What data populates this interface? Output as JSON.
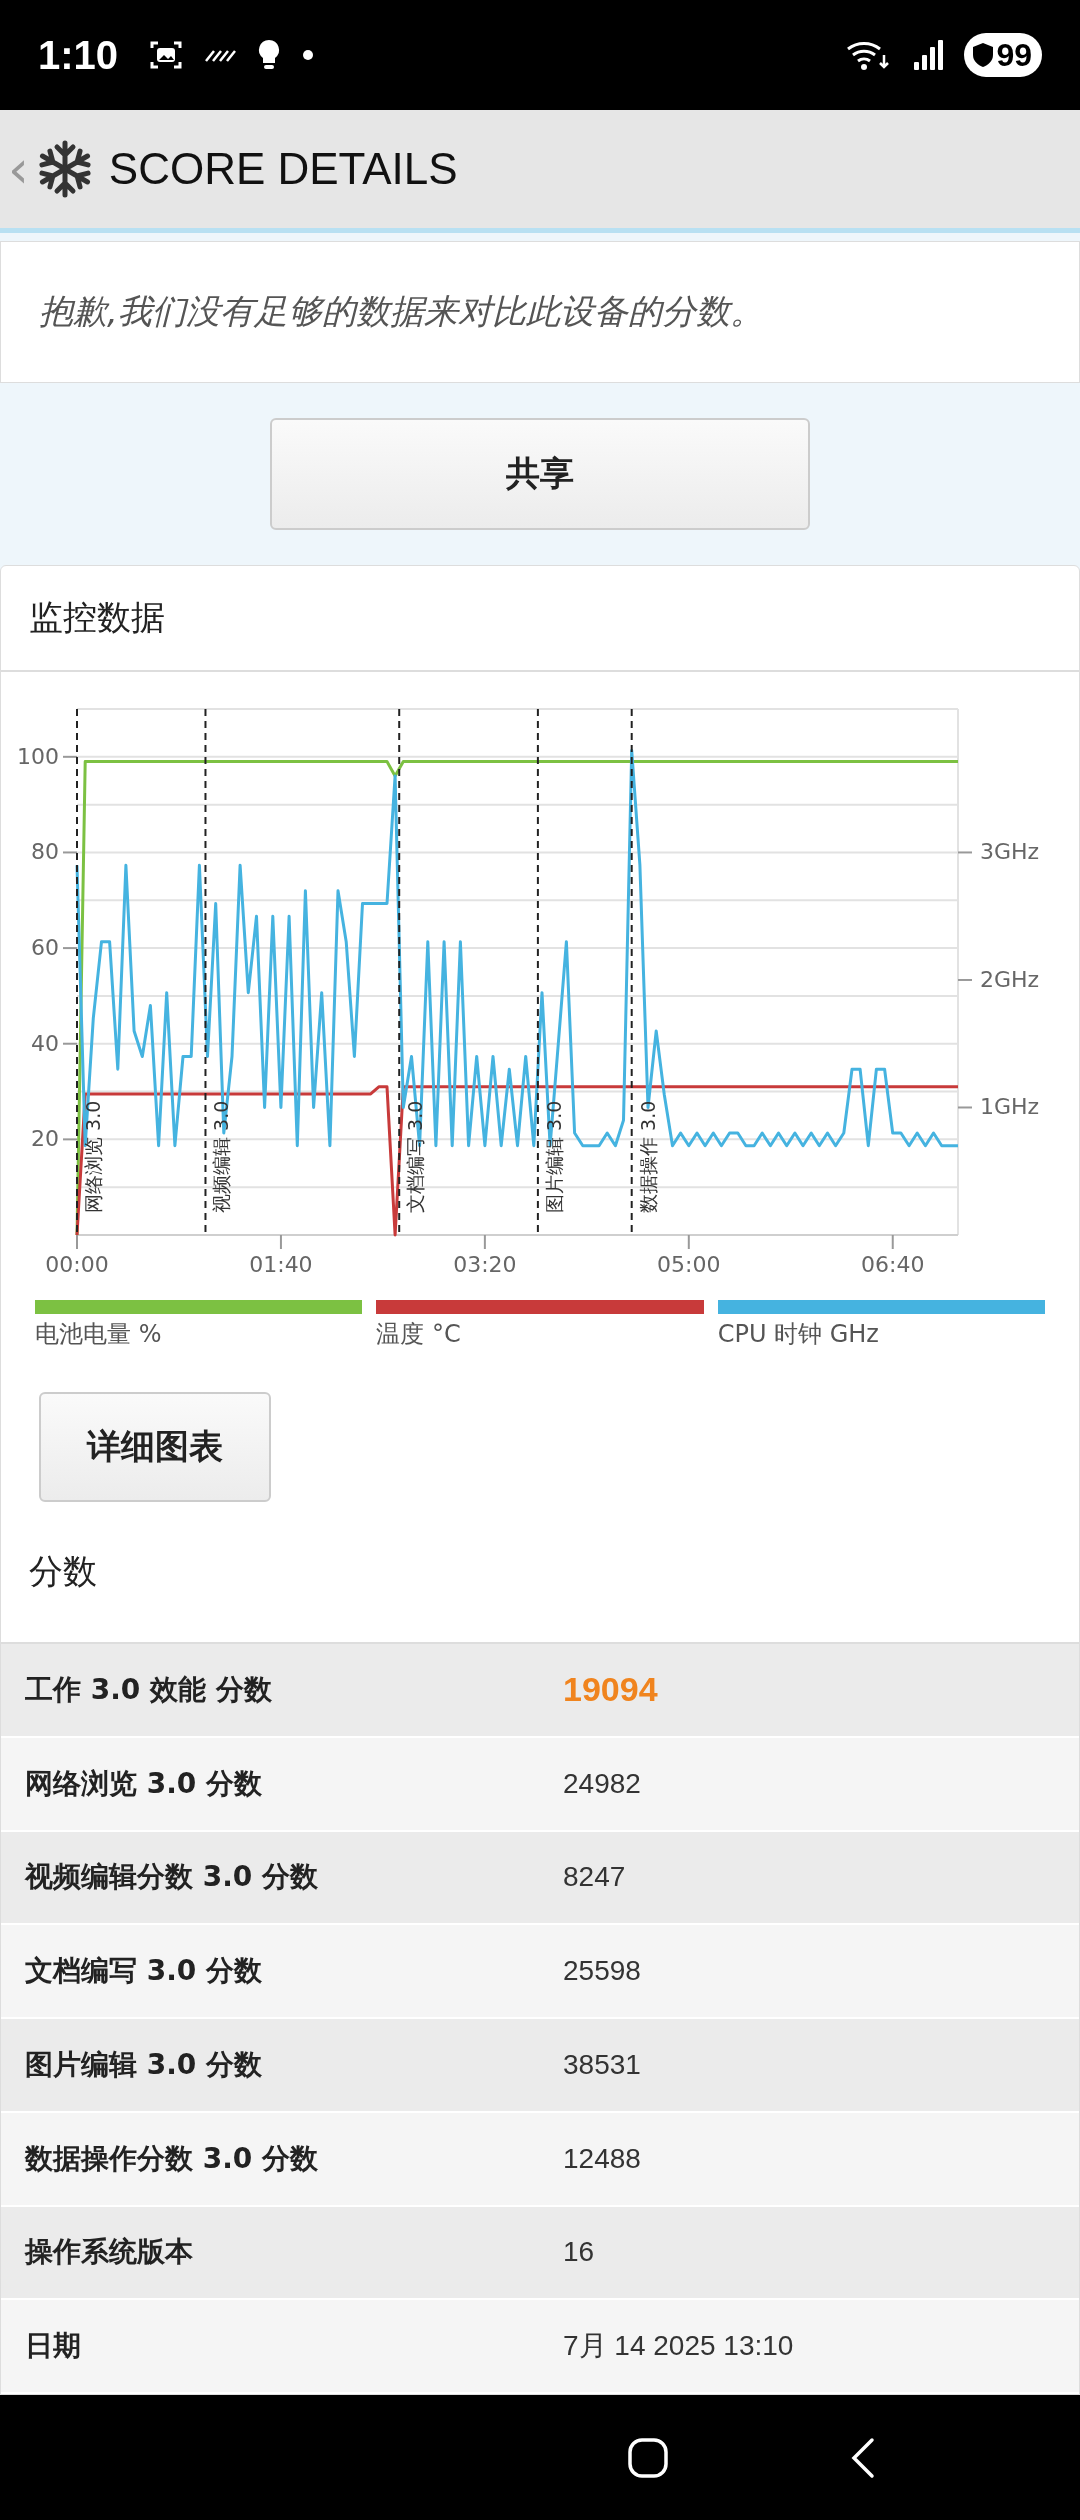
{
  "status_bar": {
    "time": "1:10",
    "battery": "99"
  },
  "header": {
    "back": "‹",
    "title": "SCORE DETAILS"
  },
  "notice": "抱歉,我们没有足够的数据来对比此设备的分数。",
  "share_button": "共享",
  "monitoring": {
    "title": "监控数据",
    "chart_data": {
      "type": "line",
      "xlim": [
        0,
        432
      ],
      "ylim": [
        0,
        110
      ],
      "y2lim": [
        0,
        4.125
      ],
      "x": [
        0,
        4,
        8,
        12,
        16,
        20,
        24,
        28,
        32,
        36,
        40,
        44,
        48,
        52,
        56,
        60,
        64,
        68,
        72,
        76,
        80,
        84,
        88,
        92,
        96,
        100,
        104,
        108,
        112,
        116,
        120,
        124,
        128,
        132,
        136,
        140,
        144,
        148,
        152,
        156,
        160,
        164,
        168,
        172,
        176,
        180,
        184,
        188,
        192,
        196,
        200,
        204,
        208,
        212,
        216,
        220,
        224,
        228,
        232,
        236,
        240,
        244,
        248,
        252,
        256,
        260,
        264,
        268,
        272,
        276,
        280,
        284,
        288,
        292,
        296,
        300,
        304,
        308,
        312,
        316,
        320,
        324,
        328,
        332,
        336,
        340,
        344,
        348,
        352,
        356,
        360,
        364,
        368,
        372,
        376,
        380,
        384,
        388,
        392,
        396,
        400,
        404,
        408,
        412,
        416,
        420,
        424,
        428,
        432
      ],
      "xticks": [
        {
          "value": 0,
          "label": "00:00"
        },
        {
          "value": 100,
          "label": "01:40"
        },
        {
          "value": 200,
          "label": "03:20"
        },
        {
          "value": 300,
          "label": "05:00"
        },
        {
          "value": 400,
          "label": "06:40"
        }
      ],
      "yticks": [
        20,
        40,
        60,
        80,
        100
      ],
      "y2ticks": [
        {
          "value": 1,
          "label": "1GHz"
        },
        {
          "value": 2,
          "label": "2GHz"
        },
        {
          "value": 3,
          "label": "3GHz"
        }
      ],
      "series": [
        {
          "name": "电池电量 %",
          "color": "#7cc142",
          "values": [
            0,
            99,
            99,
            99,
            99,
            99,
            99,
            99,
            99,
            99,
            99,
            99,
            99,
            99,
            99,
            99,
            99,
            99,
            99,
            99,
            99,
            99,
            99,
            99,
            99,
            99,
            99,
            99,
            99,
            99,
            99,
            99,
            99,
            99,
            99,
            99,
            99,
            99,
            99,
            96,
            99,
            99,
            99,
            99,
            99,
            99,
            99,
            99,
            99,
            99,
            99,
            99,
            99,
            99,
            99,
            99,
            99,
            99,
            99,
            99,
            99,
            99,
            99,
            99,
            99,
            99,
            99,
            99,
            99,
            99,
            99,
            99,
            99,
            99,
            99,
            99,
            99,
            99,
            99,
            99,
            99,
            99,
            99,
            99,
            99,
            99,
            99,
            99,
            99,
            99,
            99,
            99,
            99,
            99,
            99,
            99,
            99,
            99,
            99,
            99,
            99,
            99,
            99,
            99,
            99,
            99,
            99,
            99,
            99
          ]
        },
        {
          "name": "温度 °C",
          "color": "#c83a3a",
          "values": [
            0,
            29.5,
            29.5,
            29.5,
            29.5,
            29.5,
            29.5,
            29.5,
            29.5,
            29.5,
            29.5,
            29.5,
            29.5,
            29.5,
            29.5,
            29.5,
            29.5,
            29.5,
            29.5,
            29.5,
            29.5,
            29.5,
            29.5,
            29.5,
            29.5,
            29.5,
            29.5,
            29.5,
            29.5,
            29.5,
            29.5,
            29.5,
            29.5,
            29.5,
            29.5,
            29.5,
            29.5,
            31,
            31,
            0,
            31,
            31,
            31,
            31,
            31,
            31,
            31,
            31,
            31,
            31,
            31,
            31,
            31,
            31,
            31,
            31,
            31,
            31,
            31,
            31,
            31,
            31,
            31,
            31,
            31,
            31,
            31,
            31,
            31,
            31,
            31,
            31,
            31,
            31,
            31,
            31,
            31,
            31,
            31,
            31,
            31,
            31,
            31,
            31,
            31,
            31,
            31,
            31,
            31,
            31,
            31,
            31,
            31,
            31,
            31,
            31,
            31,
            31,
            31,
            31,
            31,
            31,
            31,
            31,
            31,
            31,
            31,
            31,
            31
          ]
        },
        {
          "name": "CPU 时钟 GHz",
          "color": "#45b3e0",
          "axis": "y2",
          "values": [
            2.9,
            0.7,
            1.7,
            2.3,
            2.3,
            1.3,
            2.9,
            1.6,
            1.4,
            1.8,
            0.7,
            1.9,
            0.7,
            1.4,
            1.4,
            2.9,
            1.4,
            2.6,
            0.8,
            1.4,
            2.9,
            1.9,
            2.5,
            1.0,
            2.5,
            1.0,
            2.5,
            0.7,
            2.7,
            1.0,
            1.9,
            0.7,
            2.7,
            2.3,
            1.4,
            2.6,
            2.6,
            2.6,
            2.6,
            3.6,
            1.0,
            1.4,
            0.7,
            2.3,
            0.7,
            2.3,
            0.7,
            2.3,
            0.7,
            1.4,
            0.7,
            1.4,
            0.7,
            1.3,
            0.7,
            1.4,
            0.7,
            1.9,
            0.7,
            1.5,
            2.3,
            0.8,
            0.7,
            0.7,
            0.7,
            0.8,
            0.7,
            0.9,
            3.8,
            2.9,
            1.0,
            1.6,
            1.1,
            0.7,
            0.8,
            0.7,
            0.8,
            0.7,
            0.8,
            0.7,
            0.8,
            0.8,
            0.7,
            0.7,
            0.8,
            0.7,
            0.8,
            0.7,
            0.8,
            0.7,
            0.8,
            0.7,
            0.8,
            0.7,
            0.8,
            1.3,
            1.3,
            0.7,
            1.3,
            1.3,
            0.8,
            0.8,
            0.7,
            0.8,
            0.7,
            0.8,
            0.7,
            0.7,
            0.7
          ]
        }
      ],
      "grid": true,
      "ref_lines": [
        {
          "axis": "x",
          "value": 0,
          "label": "网络浏览 3.0"
        },
        {
          "axis": "x",
          "value": 63,
          "label": "视频编辑 3.0"
        },
        {
          "axis": "x",
          "value": 158,
          "label": "文档编写 3.0"
        },
        {
          "axis": "x",
          "value": 226,
          "label": "图片编辑 3.0"
        },
        {
          "axis": "x",
          "value": 272,
          "label": "数据操作 3.0"
        }
      ]
    },
    "detail_button": "详细图表"
  },
  "scores": {
    "title": "分数",
    "rows": [
      {
        "label": "工作 3.0 效能 分数",
        "value": "19094",
        "emphasized": true
      },
      {
        "label": "网络浏览 3.0 分数",
        "value": "24982",
        "emphasized": false
      },
      {
        "label": "视频编辑分数 3.0 分数",
        "value": "8247",
        "emphasized": false
      },
      {
        "label": "文档编写 3.0 分数",
        "value": "25598",
        "emphasized": false
      },
      {
        "label": "图片编辑 3.0 分数",
        "value": "38531",
        "emphasized": false
      },
      {
        "label": "数据操作分数 3.0 分数",
        "value": "12488",
        "emphasized": false
      },
      {
        "label": "操作系统版本",
        "value": "16",
        "emphasized": false
      },
      {
        "label": "日期",
        "value": "7月 14 2025 13:10",
        "emphasized": false
      }
    ]
  }
}
